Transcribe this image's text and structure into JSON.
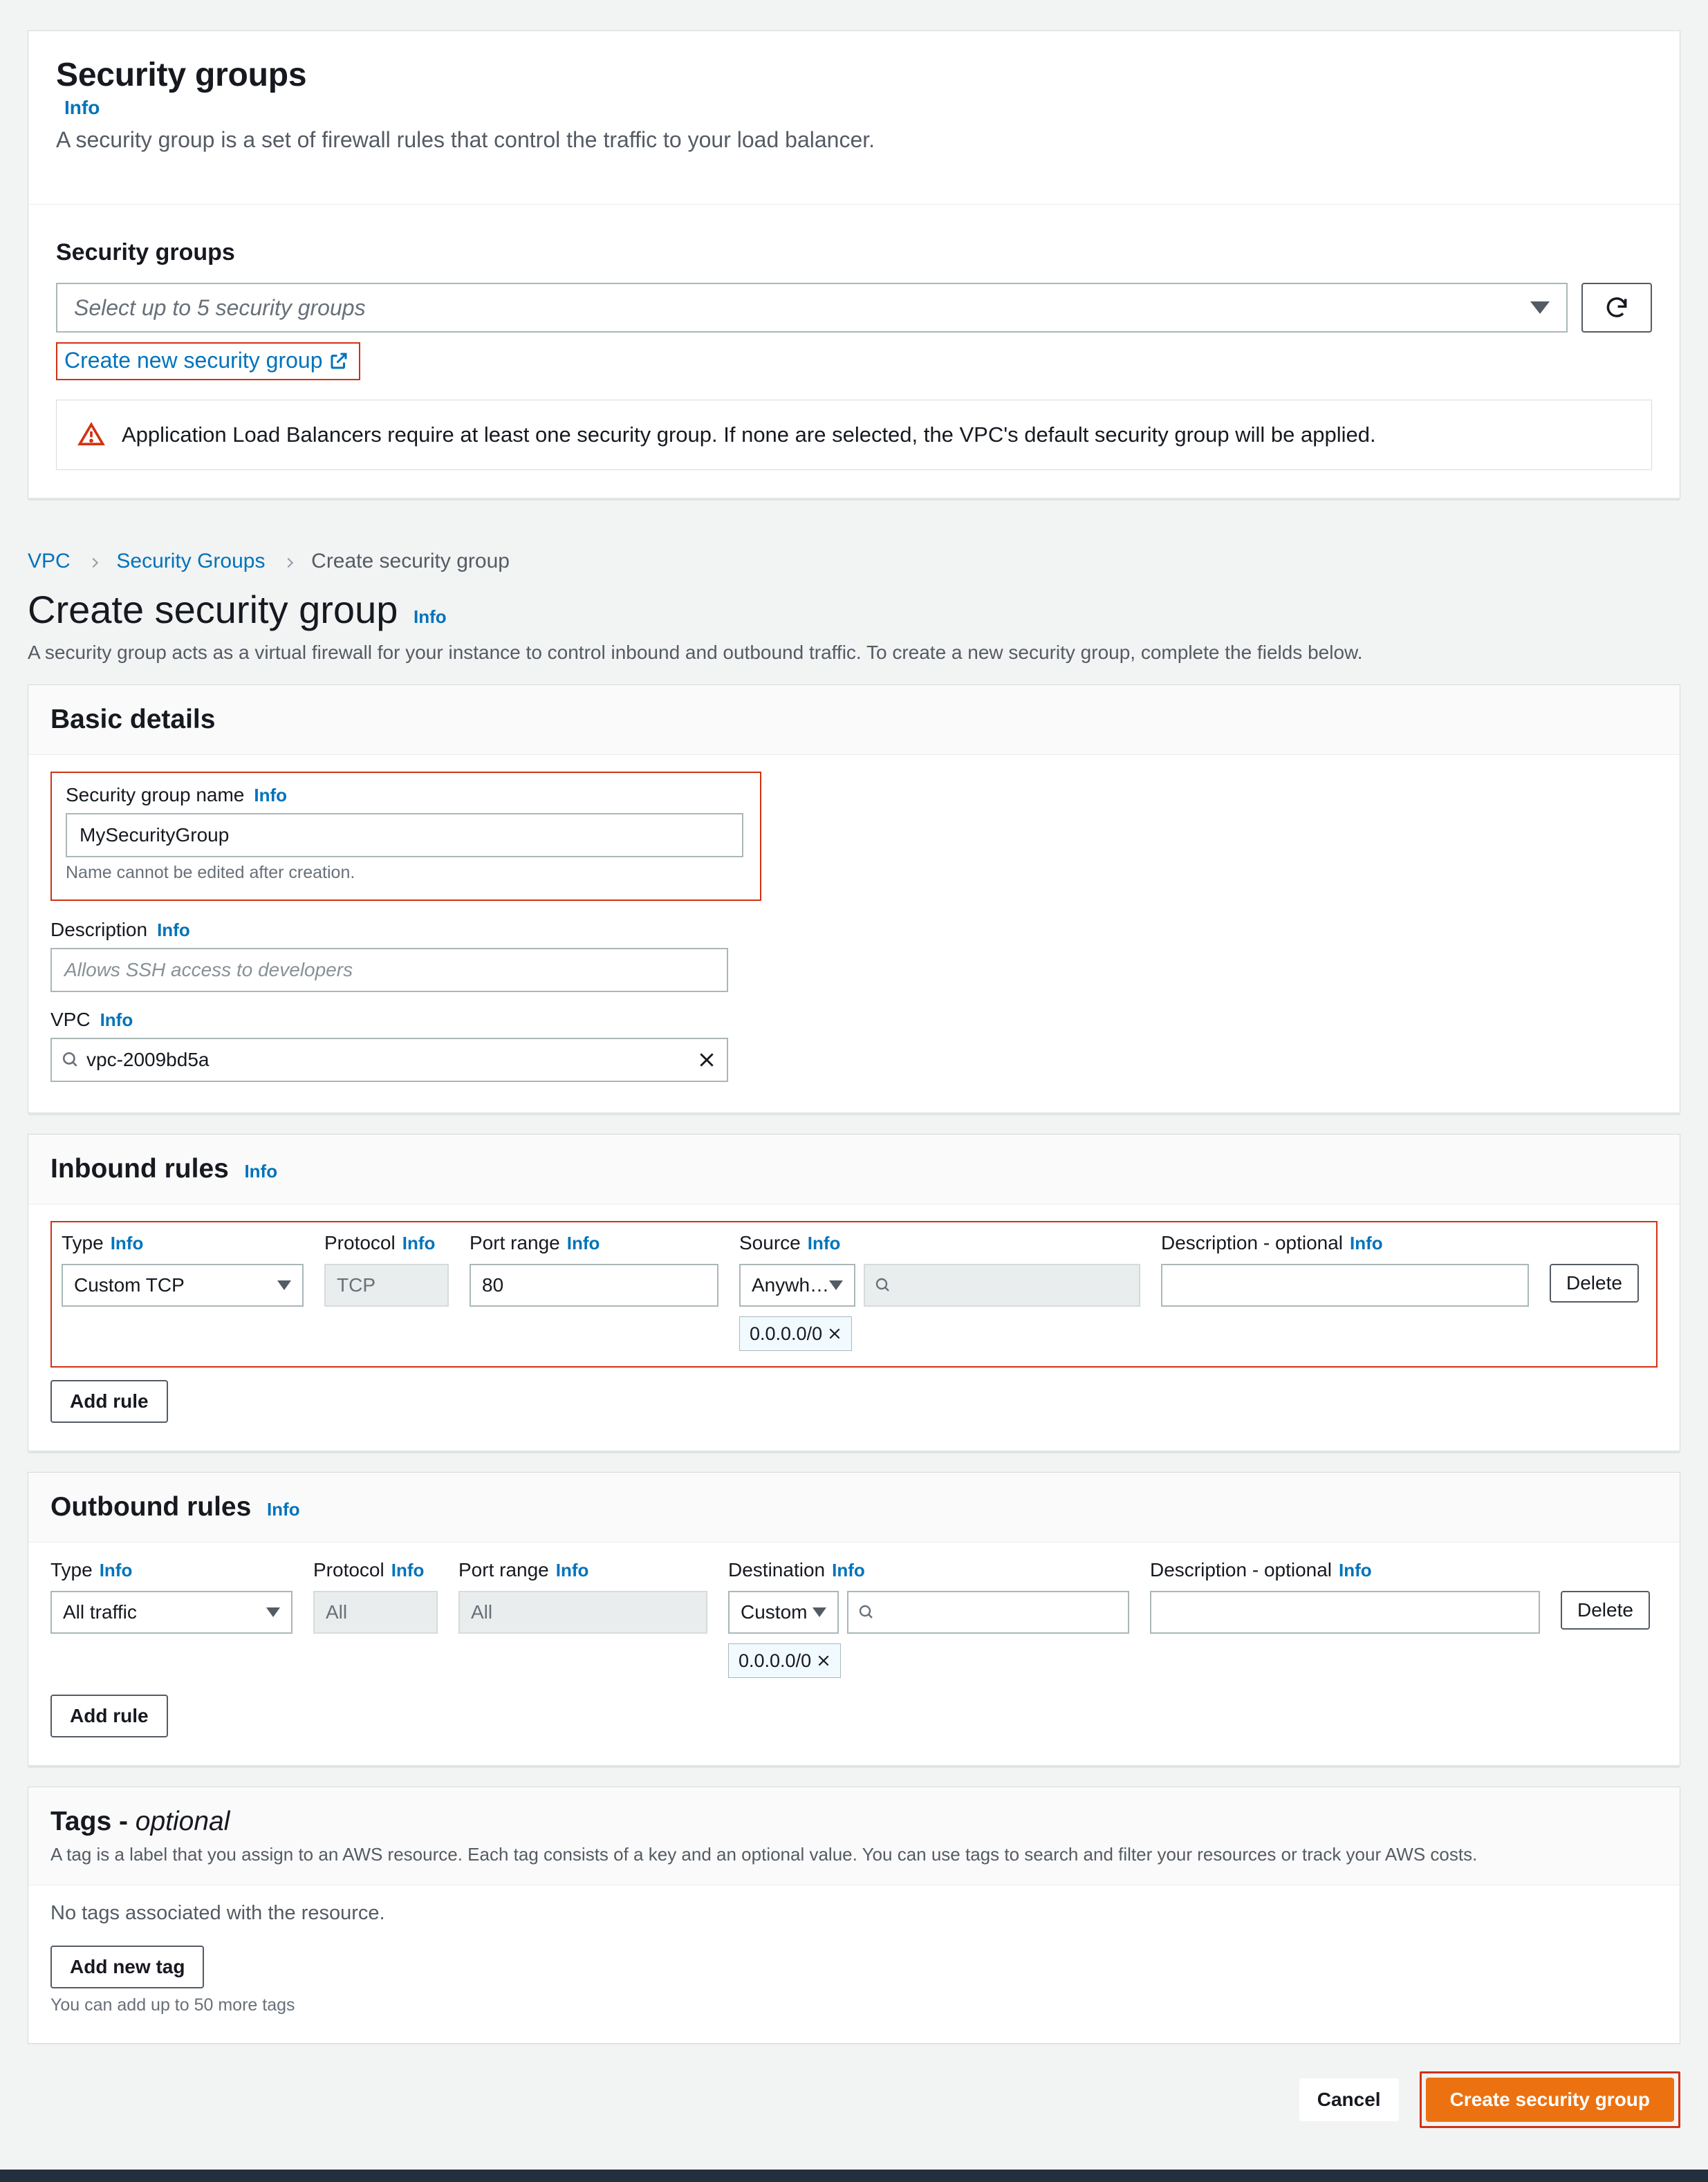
{
  "sg_panel": {
    "title": "Security groups",
    "info": "Info",
    "subtitle": "A security group is a set of firewall rules that control the traffic to your load balancer.",
    "section_label": "Security groups",
    "dd_placeholder": "Select up to 5 security groups",
    "create_link": "Create new security group",
    "alert": "Application Load Balancers require at least one security group. If none are selected, the VPC's default security group will be applied."
  },
  "breadcrumb": {
    "a": "VPC",
    "b": "Security Groups",
    "c": "Create security group"
  },
  "page": {
    "title": "Create security group",
    "info": "Info",
    "subtitle": "A security group acts as a virtual firewall for your instance to control inbound and outbound traffic. To create a new security group, complete the fields below."
  },
  "basic": {
    "heading": "Basic details",
    "name_label": "Security group name",
    "name_value": "MySecurityGroup",
    "name_hint": "Name cannot be edited after creation.",
    "desc_label": "Description",
    "desc_placeholder": "Allows SSH access to developers",
    "vpc_label": "VPC",
    "vpc_value": "vpc-2009bd5a"
  },
  "inbound": {
    "heading": "Inbound rules",
    "cols": {
      "type": "Type",
      "proto": "Protocol",
      "port": "Port range",
      "src": "Source",
      "desc": "Description - optional"
    },
    "row": {
      "type": "Custom TCP",
      "proto": "TCP",
      "port": "80",
      "src_sel": "Anywh…",
      "cidr": "0.0.0.0/0",
      "delete": "Delete"
    },
    "add": "Add rule"
  },
  "outbound": {
    "heading": "Outbound rules",
    "cols": {
      "type": "Type",
      "proto": "Protocol",
      "port": "Port range",
      "dst": "Destination",
      "desc": "Description - optional"
    },
    "row": {
      "type": "All traffic",
      "proto": "All",
      "port": "All",
      "dst_sel": "Custom",
      "cidr": "0.0.0.0/0",
      "delete": "Delete"
    },
    "add": "Add rule"
  },
  "tags": {
    "heading": "Tags - ",
    "optional": "optional",
    "desc": "A tag is a label that you assign to an AWS resource. Each tag consists of a key and an optional value. You can use tags to search and filter your resources or track your AWS costs.",
    "empty": "No tags associated with the resource.",
    "add": "Add new tag",
    "hint": "You can add up to 50 more tags"
  },
  "actions": {
    "cancel": "Cancel",
    "create": "Create security group"
  },
  "info": "Info"
}
